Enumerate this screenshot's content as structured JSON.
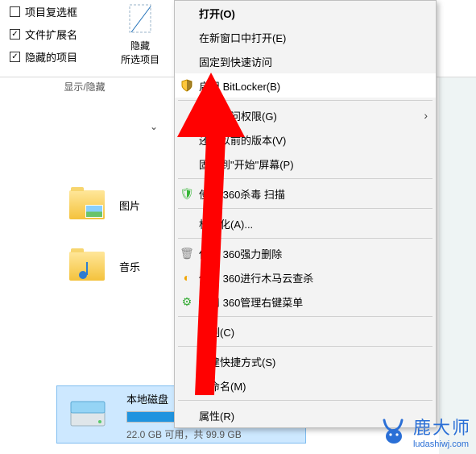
{
  "ribbon": {
    "checkboxes": [
      {
        "label": "项目复选框",
        "checked": false
      },
      {
        "label": "文件扩展名",
        "checked": true
      },
      {
        "label": "隐藏的项目",
        "checked": true
      }
    ],
    "hide_selected": {
      "line1": "隐藏",
      "line2": "所选项目"
    },
    "section_caption": "显示/隐藏"
  },
  "folders": {
    "pictures": "图片",
    "music": "音乐"
  },
  "drive": {
    "title": "本地磁盘",
    "size_line": "22.0 GB 可用，共 99.9 GB",
    "fill_pct": 77,
    "colors": {
      "fill": "#2094df",
      "selection": "#cde8ff"
    }
  },
  "context_menu": {
    "open": "打开(O)",
    "open_new_window": "在新窗口中打开(E)",
    "pin_quick": "固定到快速访问",
    "bitlocker": "启用 BitLocker(B)",
    "grant_access": "授予访问权限(G)",
    "restore_prev": "还原以前的版本(V)",
    "pin_start": "固定到\"开始\"屏幕(P)",
    "scan_360": "使用 360杀毒 扫描",
    "format": "格式化(A)...",
    "force_delete": "使用 360强力删除",
    "trojan_scan": "使用 360进行木马云查杀",
    "manage_menu": "使用 360管理右键菜单",
    "copy": "复制(C)",
    "shortcut": "创建快捷方式(S)",
    "rename": "重命名(M)",
    "properties": "属性(R)"
  },
  "icons": {
    "shield": "🛡",
    "green_shield": "🛡",
    "trash": "🗑",
    "strong_del": "✖",
    "scan": "🔍",
    "gear": "⚙",
    "disk": "💽"
  },
  "annotation_color": "#ff0000",
  "watermark": {
    "brand": "鹿大师",
    "url": "ludashiwj.com"
  }
}
